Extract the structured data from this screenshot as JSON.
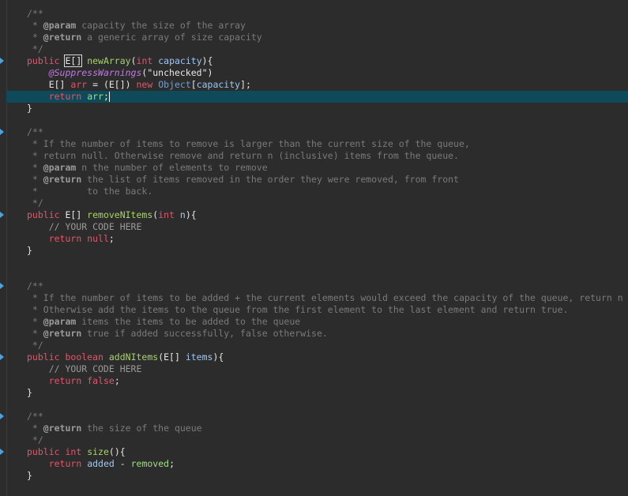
{
  "editor": {
    "lines": [
      {
        "tokens": [
          {
            "t": "/**",
            "c": "comment"
          }
        ]
      },
      {
        "tokens": [
          {
            "t": " * ",
            "c": "comment"
          },
          {
            "t": "@param",
            "c": "doctag"
          },
          {
            "t": " capacity the size of the array",
            "c": "comment"
          }
        ]
      },
      {
        "tokens": [
          {
            "t": " * ",
            "c": "comment"
          },
          {
            "t": "@return",
            "c": "doctag"
          },
          {
            "t": " a generic array of size capacity",
            "c": "comment"
          }
        ]
      },
      {
        "tokens": [
          {
            "t": " */",
            "c": "comment"
          }
        ]
      },
      {
        "marker": true,
        "tokens": [
          {
            "t": "public ",
            "c": "kw"
          },
          {
            "t": "E[]",
            "c": "plain boxed"
          },
          {
            "t": " ",
            "c": "plain"
          },
          {
            "t": "newArray",
            "c": "method"
          },
          {
            "t": "(",
            "c": "plain"
          },
          {
            "t": "int",
            "c": "kw"
          },
          {
            "t": " ",
            "c": "plain"
          },
          {
            "t": "capacity",
            "c": "param"
          },
          {
            "t": "){",
            "c": "plain"
          }
        ]
      },
      {
        "tokens": [
          {
            "t": "    ",
            "c": "plain"
          },
          {
            "t": "@SuppressWarnings",
            "c": "annotation"
          },
          {
            "t": "(\"unchecked\")",
            "c": "string"
          }
        ]
      },
      {
        "tokens": [
          {
            "t": "    E[] ",
            "c": "plain"
          },
          {
            "t": "arr",
            "c": "kw"
          },
          {
            "t": " = (E[]) ",
            "c": "plain"
          },
          {
            "t": "new",
            "c": "kw"
          },
          {
            "t": " ",
            "c": "plain"
          },
          {
            "t": "Object",
            "c": "type"
          },
          {
            "t": "[",
            "c": "plain"
          },
          {
            "t": "capacity",
            "c": "param"
          },
          {
            "t": "];",
            "c": "plain"
          }
        ]
      },
      {
        "highlight": true,
        "tokens": [
          {
            "t": "    ",
            "c": "plain"
          },
          {
            "t": "return",
            "c": "kw"
          },
          {
            "t": " ",
            "c": "plain"
          },
          {
            "t": "arr",
            "c": "var"
          },
          {
            "t": ";",
            "c": "plain"
          }
        ],
        "cursor": true
      },
      {
        "tokens": [
          {
            "t": "}",
            "c": "plain"
          }
        ]
      },
      {
        "tokens": []
      },
      {
        "marker": true,
        "tokens": [
          {
            "t": "/**",
            "c": "comment"
          }
        ]
      },
      {
        "tokens": [
          {
            "t": " * If the number of items to remove is larger than the current size of the queue,",
            "c": "comment"
          }
        ]
      },
      {
        "tokens": [
          {
            "t": " * return null. Otherwise remove and return n (inclusive) items from the queue.",
            "c": "comment"
          }
        ]
      },
      {
        "tokens": [
          {
            "t": " * ",
            "c": "comment"
          },
          {
            "t": "@param",
            "c": "doctag"
          },
          {
            "t": " n the number of elements to remove",
            "c": "comment"
          }
        ]
      },
      {
        "tokens": [
          {
            "t": " * ",
            "c": "comment"
          },
          {
            "t": "@return",
            "c": "doctag"
          },
          {
            "t": " the list of items removed in the order they were removed, from front",
            "c": "comment"
          }
        ]
      },
      {
        "tokens": [
          {
            "t": " *         to the back.",
            "c": "comment"
          }
        ]
      },
      {
        "tokens": [
          {
            "t": " */",
            "c": "comment"
          }
        ]
      },
      {
        "marker": true,
        "tokens": [
          {
            "t": "public ",
            "c": "kw"
          },
          {
            "t": "E[] ",
            "c": "plain"
          },
          {
            "t": "removeNItems",
            "c": "method"
          },
          {
            "t": "(",
            "c": "plain"
          },
          {
            "t": "int",
            "c": "kw"
          },
          {
            "t": " ",
            "c": "plain"
          },
          {
            "t": "n",
            "c": "param"
          },
          {
            "t": "){",
            "c": "plain"
          }
        ]
      },
      {
        "tokens": [
          {
            "t": "    // YOUR CODE HERE",
            "c": "yourcode"
          }
        ]
      },
      {
        "tokens": [
          {
            "t": "    ",
            "c": "plain"
          },
          {
            "t": "return",
            "c": "kw"
          },
          {
            "t": " ",
            "c": "plain"
          },
          {
            "t": "null",
            "c": "kw"
          },
          {
            "t": ";",
            "c": "plain"
          }
        ]
      },
      {
        "tokens": [
          {
            "t": "}",
            "c": "plain"
          }
        ]
      },
      {
        "tokens": []
      },
      {
        "tokens": []
      },
      {
        "marker": true,
        "tokens": [
          {
            "t": "/**",
            "c": "comment"
          }
        ]
      },
      {
        "tokens": [
          {
            "t": " * If the number of items to be added + the current elements would exceed the capacity of the queue, return n",
            "c": "comment"
          }
        ]
      },
      {
        "tokens": [
          {
            "t": " * Otherwise add the items to the queue from the first element to the last element and return true.",
            "c": "comment"
          }
        ]
      },
      {
        "tokens": [
          {
            "t": " * ",
            "c": "comment"
          },
          {
            "t": "@param",
            "c": "doctag"
          },
          {
            "t": " items the items to be added to the queue",
            "c": "comment"
          }
        ]
      },
      {
        "tokens": [
          {
            "t": " * ",
            "c": "comment"
          },
          {
            "t": "@return",
            "c": "doctag"
          },
          {
            "t": " true if added successfully, false otherwise.",
            "c": "comment"
          }
        ]
      },
      {
        "tokens": [
          {
            "t": " */",
            "c": "comment"
          }
        ]
      },
      {
        "marker": true,
        "tokens": [
          {
            "t": "public ",
            "c": "kw"
          },
          {
            "t": "boolean",
            "c": "kw"
          },
          {
            "t": " ",
            "c": "plain"
          },
          {
            "t": "addNItems",
            "c": "method"
          },
          {
            "t": "(E[] ",
            "c": "plain"
          },
          {
            "t": "items",
            "c": "param"
          },
          {
            "t": "){",
            "c": "plain"
          }
        ]
      },
      {
        "tokens": [
          {
            "t": "    // YOUR CODE HERE",
            "c": "yourcode"
          }
        ]
      },
      {
        "tokens": [
          {
            "t": "    ",
            "c": "plain"
          },
          {
            "t": "return",
            "c": "kw"
          },
          {
            "t": " ",
            "c": "plain"
          },
          {
            "t": "false",
            "c": "kw"
          },
          {
            "t": ";",
            "c": "plain"
          }
        ]
      },
      {
        "tokens": [
          {
            "t": "}",
            "c": "plain"
          }
        ]
      },
      {
        "tokens": []
      },
      {
        "marker": true,
        "tokens": [
          {
            "t": "/**",
            "c": "comment"
          }
        ]
      },
      {
        "tokens": [
          {
            "t": " * ",
            "c": "comment"
          },
          {
            "t": "@return",
            "c": "doctag"
          },
          {
            "t": " the size of the queue",
            "c": "comment"
          }
        ]
      },
      {
        "tokens": [
          {
            "t": " */",
            "c": "comment"
          }
        ]
      },
      {
        "marker": true,
        "tokens": [
          {
            "t": "public ",
            "c": "kw"
          },
          {
            "t": "int",
            "c": "kw"
          },
          {
            "t": " ",
            "c": "plain"
          },
          {
            "t": "size",
            "c": "method"
          },
          {
            "t": "(){",
            "c": "plain"
          }
        ]
      },
      {
        "tokens": [
          {
            "t": "    ",
            "c": "plain"
          },
          {
            "t": "return",
            "c": "kw"
          },
          {
            "t": " ",
            "c": "plain"
          },
          {
            "t": "added",
            "c": "param"
          },
          {
            "t": " - ",
            "c": "plain"
          },
          {
            "t": "removed",
            "c": "var"
          },
          {
            "t": ";",
            "c": "plain"
          }
        ]
      },
      {
        "tokens": [
          {
            "t": "}",
            "c": "plain"
          }
        ]
      }
    ]
  },
  "colors": {
    "background": "#2c2c2c",
    "keyword": "#e0566b",
    "method": "#a8d26a",
    "comment": "#7a7a7a",
    "highlight_line": "#0f4a5a"
  }
}
